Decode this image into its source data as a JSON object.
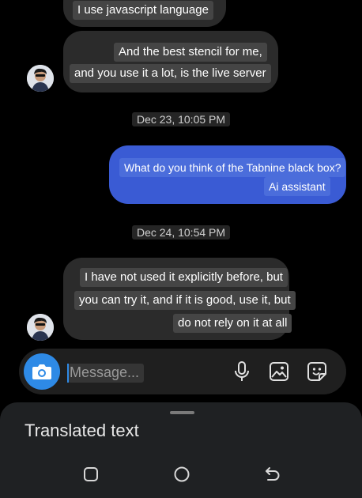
{
  "messages": [
    {
      "id": "m1",
      "direction": "incoming",
      "lines": [
        "I use javascript language"
      ]
    },
    {
      "id": "m2",
      "direction": "incoming",
      "lines": [
        "And the best stencil for me,",
        "and you use it a lot, is the live server"
      ]
    },
    {
      "id": "d1",
      "type": "date",
      "text": "Dec 23, 10:05 PM"
    },
    {
      "id": "m3",
      "direction": "outgoing",
      "lines": [
        "What do you think of the Tabnine black box?",
        "Ai assistant"
      ]
    },
    {
      "id": "d2",
      "type": "date",
      "text": "Dec 24, 10:54 PM"
    },
    {
      "id": "m4",
      "direction": "incoming",
      "lines": [
        "I have not used it explicitly before, but",
        "you can try it, and if it is good, use it, but",
        "do not rely on it at all"
      ]
    }
  ],
  "composer": {
    "placeholder": "Message...",
    "icons": [
      "camera-icon",
      "microphone-icon",
      "gallery-icon",
      "sticker-icon"
    ]
  },
  "translation_sheet": {
    "title": "Translated text"
  },
  "nav_bar": {
    "icons": [
      "recents-icon",
      "home-icon",
      "back-icon"
    ]
  },
  "colors": {
    "background": "#000000",
    "incoming_bubble": "#2b2b2b",
    "outgoing_bubble": "#3a5bd4",
    "accent": "#2e8ae6"
  }
}
